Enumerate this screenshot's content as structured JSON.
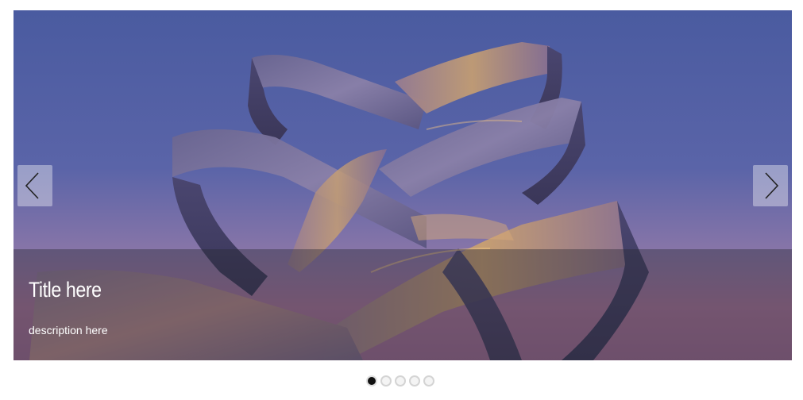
{
  "slider": {
    "slides": [
      {
        "title": "Title here",
        "description": "description here"
      }
    ],
    "active_index": 0,
    "dot_count": 5,
    "prev_icon": "chevron-left-icon",
    "next_icon": "chevron-right-icon"
  },
  "colors": {
    "sky_top": "#4d5ea3",
    "sky_bottom": "#a5729f",
    "caption_overlay": "#28283266",
    "active_dot": "#111111"
  }
}
